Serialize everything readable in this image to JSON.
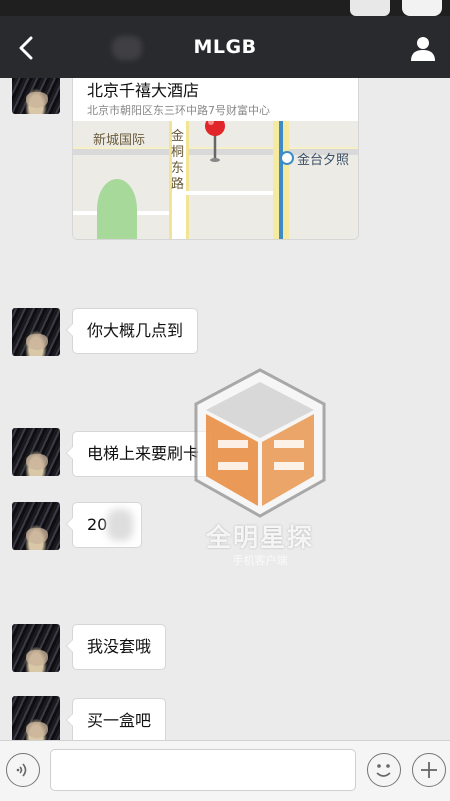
{
  "header": {
    "title": "MLGB"
  },
  "messages": [
    {
      "type": "location",
      "name": "北京千禧大酒店",
      "address": "北京市朝阳区东三环中路7号财富中心",
      "map_labels": {
        "district": "新城国际",
        "road": "金桐东路",
        "station": "金台夕照"
      }
    },
    {
      "type": "text",
      "text": "你大概几点到"
    },
    {
      "type": "text",
      "text": "电梯上来要刷卡"
    },
    {
      "type": "text",
      "text": "20"
    },
    {
      "type": "text",
      "text": "我没套哦"
    },
    {
      "type": "text",
      "text": "买一盒吧"
    }
  ],
  "watermark": {
    "label": "全明星探",
    "sub": "手机客户端"
  },
  "icons": {
    "back": "chevron-left",
    "profile": "person",
    "voice": "voice-wave",
    "emoji": "smiley",
    "more": "plus"
  },
  "colors": {
    "header_bg": "#292a2e",
    "chat_bg": "#ebebeb",
    "bubble_bg": "#ffffff",
    "map_pin": "#e0262b",
    "watermark_orange": "#e8893a"
  }
}
